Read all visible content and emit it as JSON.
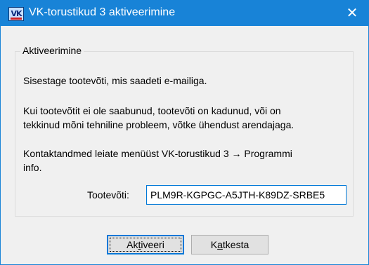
{
  "window": {
    "title": "VK-torustikud 3 aktiveerimine",
    "app_icon_text": "VK",
    "close_glyph": "✕",
    "accent_color": "#1883d7"
  },
  "group": {
    "legend": "Aktiveerimine",
    "line1": "Sisestage tootevõti, mis saadeti e-mailiga.",
    "line2a": "Kui tootevõtit ei ole saabunud, tootevõti on kadunud, või on",
    "line2b": "tekkinud mõni tehniline probleem, võtke ühendust arendajaga.",
    "line3a": "Kontaktandmed leiate menüüst VK-torustikud 3 → Programmi",
    "line3b": "info."
  },
  "key_field": {
    "label": "Tootevõti:",
    "value": "PLM9R-KGPGC-A5JTH-K89DZ-SRBE5"
  },
  "buttons": {
    "activate_pre": "Ak",
    "activate_u": "t",
    "activate_post": "iveeri",
    "cancel_pre": "K",
    "cancel_u": "a",
    "cancel_post": "tkesta"
  }
}
